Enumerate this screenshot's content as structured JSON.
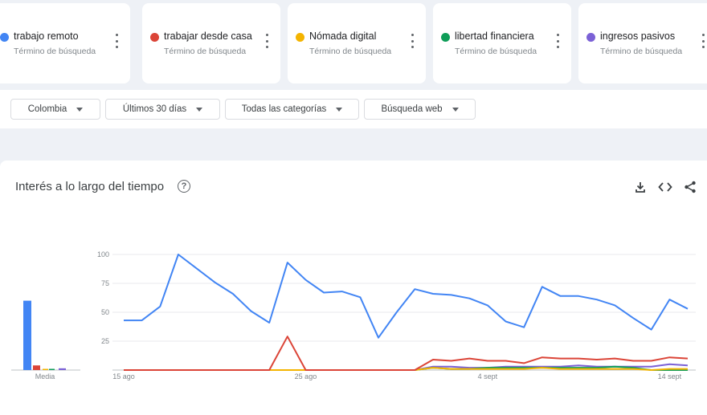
{
  "terms": [
    {
      "name": "trabajo remoto",
      "sub": "Término de búsqueda",
      "color": "#4285f4"
    },
    {
      "name": "trabajar desde casa",
      "sub": "Término de búsqueda",
      "color": "#db4437"
    },
    {
      "name": "Nómada digital",
      "sub": "Término de búsqueda",
      "color": "#f4b400"
    },
    {
      "name": "libertad financiera",
      "sub": "Término de búsqueda",
      "color": "#0f9d58"
    },
    {
      "name": "ingresos pasivos",
      "sub": "Término de búsqueda",
      "color": "#7b61d6"
    }
  ],
  "filters": {
    "region": "Colombia",
    "time": "Últimos 30 días",
    "category": "Todas las categorías",
    "search_type": "Búsqueda web"
  },
  "panel": {
    "title": "Interés a lo largo del tiempo",
    "icons": [
      "download-icon",
      "embed-code-icon",
      "share-icon"
    ]
  },
  "chart_data": {
    "type": "line",
    "yticks": [
      25,
      50,
      75,
      100
    ],
    "ylim": [
      0,
      100
    ],
    "xticks": [
      {
        "label": "15 ago",
        "index": 0
      },
      {
        "label": "25 ago",
        "index": 10
      },
      {
        "label": "4 sept",
        "index": 20
      },
      {
        "label": "14 sept",
        "index": 30
      }
    ],
    "series": [
      {
        "name": "trabajo remoto",
        "color": "#4285f4",
        "values": [
          43,
          43,
          55,
          100,
          88,
          76,
          66,
          51,
          41,
          93,
          78,
          67,
          68,
          63,
          28,
          50,
          70,
          66,
          65,
          62,
          56,
          42,
          37,
          72,
          64,
          64,
          61,
          56,
          45,
          35,
          61,
          53
        ]
      },
      {
        "name": "trabajar desde casa",
        "color": "#db4437",
        "values": [
          0,
          0,
          0,
          0,
          0,
          0,
          0,
          0,
          0,
          29,
          0,
          0,
          0,
          0,
          0,
          0,
          0,
          9,
          8,
          10,
          8,
          8,
          6,
          11,
          10,
          10,
          9,
          10,
          8,
          8,
          11,
          10
        ]
      },
      {
        "name": "Nómada digital",
        "color": "#f4b400",
        "values": [
          0,
          0,
          0,
          0,
          0,
          0,
          0,
          0,
          0,
          0,
          0,
          0,
          0,
          0,
          0,
          0,
          0,
          2,
          1,
          1,
          1,
          1,
          1,
          2,
          1,
          1,
          1,
          1,
          1,
          0,
          1,
          1
        ]
      },
      {
        "name": "libertad financiera",
        "color": "#0f9d58",
        "values": [
          0,
          0,
          0,
          0,
          0,
          0,
          0,
          0,
          0,
          0,
          0,
          0,
          0,
          0,
          0,
          0,
          0,
          2,
          1,
          1,
          2,
          2,
          2,
          2,
          2,
          2,
          2,
          3,
          2,
          0,
          0,
          0
        ]
      },
      {
        "name": "ingresos pasivos",
        "color": "#7b61d6",
        "values": [
          0,
          0,
          0,
          0,
          0,
          0,
          0,
          0,
          0,
          0,
          0,
          0,
          0,
          0,
          0,
          0,
          0,
          3,
          3,
          2,
          2,
          3,
          3,
          3,
          3,
          4,
          3,
          3,
          3,
          3,
          5,
          4
        ]
      }
    ],
    "average": {
      "label": "Media",
      "values": [
        60,
        4,
        0.5,
        0.8,
        1.5
      ]
    }
  }
}
